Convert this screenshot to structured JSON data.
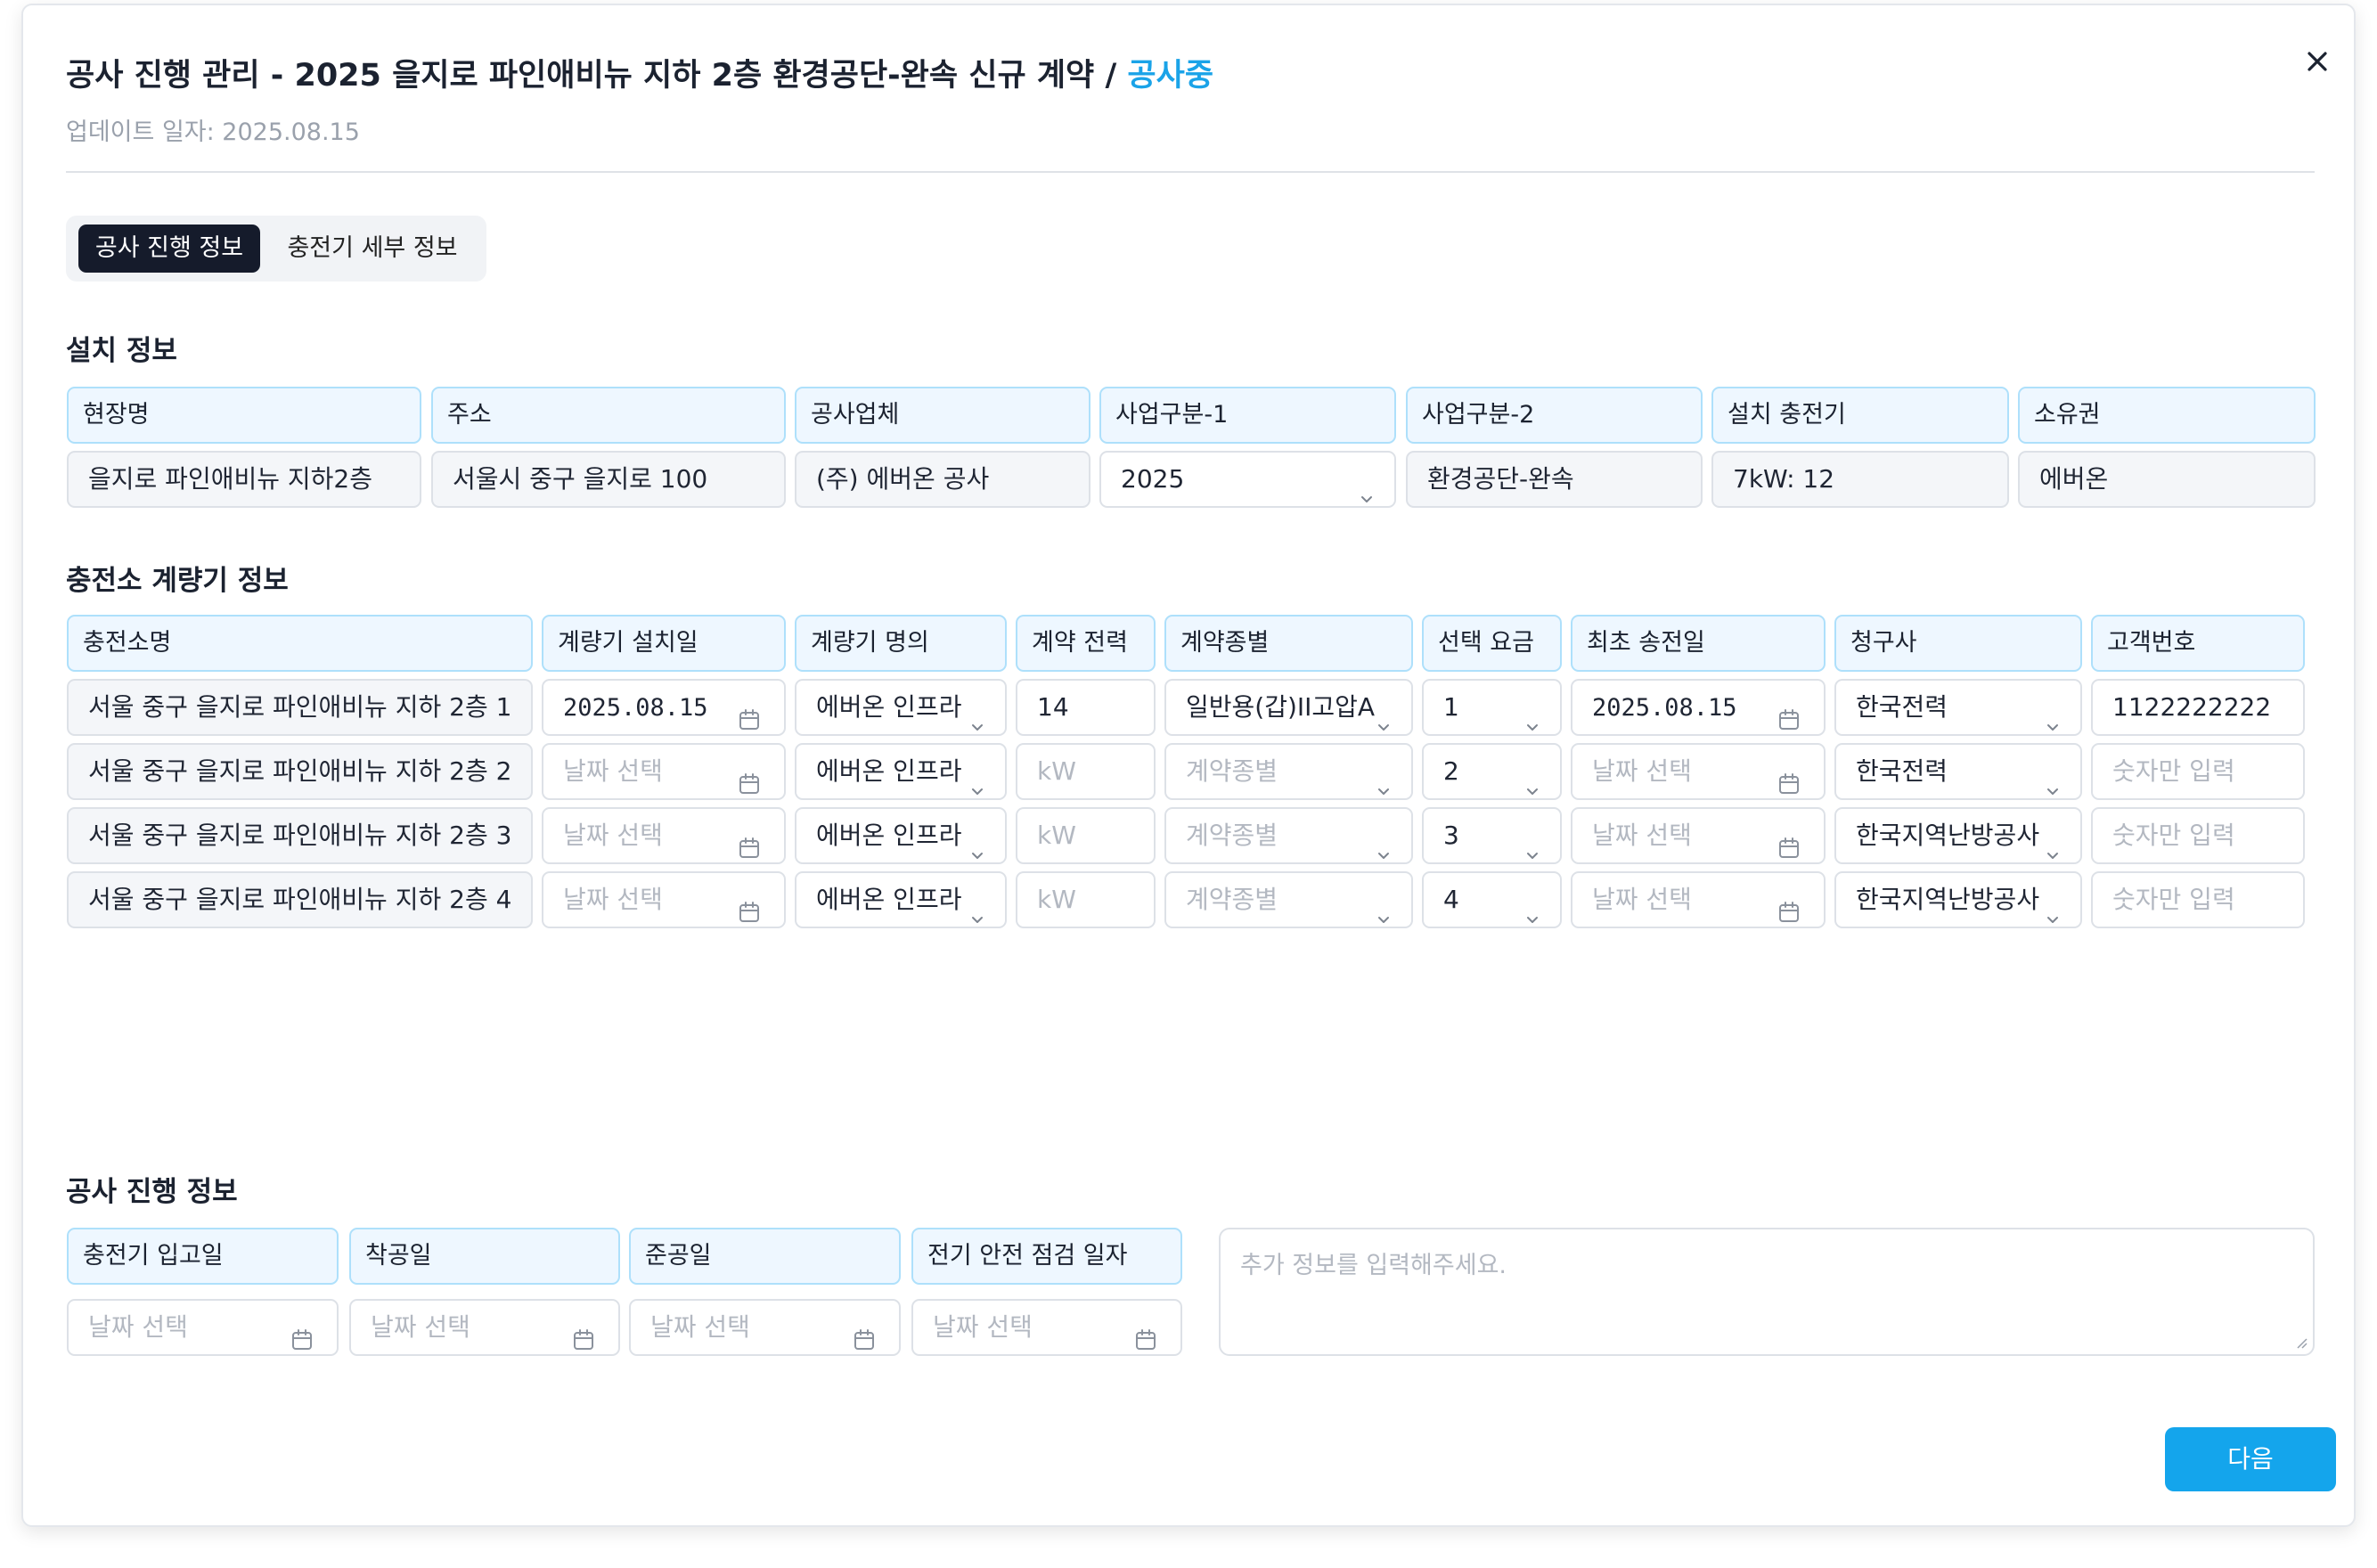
{
  "header": {
    "title": "공사 진행 관리 - 2025 을지로 파인애비뉴 지하 2층 환경공단-완속 신규 계약 / ",
    "status": "공사중",
    "updated": "업데이트 일자: 2025.08.15"
  },
  "tabs": [
    "공사 진행 정보",
    "충전기 세부 정보"
  ],
  "install": {
    "title": "설치 정보",
    "headers": [
      "현장명",
      "주소",
      "공사업체",
      "사업구분-1",
      "사업구분-2",
      "설치 충전기",
      "소유권"
    ],
    "values": [
      "을지로 파인애비뉴 지하2층",
      "서울시 중구 을지로 100",
      "(주) 에버온 공사",
      "2025",
      "환경공단-완속",
      "7kW: 12",
      "에버온"
    ]
  },
  "meter": {
    "title": "충전소 계량기 정보",
    "headers": [
      "충전소명",
      "계량기 설치일",
      "계량기 명의",
      "계약 전력",
      "계약종별",
      "선택 요금",
      "최초 송전일",
      "청구사",
      "고객번호"
    ],
    "rows": [
      {
        "name": "서울 중구 을지로 파인애비뉴 지하 2층 1",
        "install_date": "2025.08.15",
        "owner": "에버온 인프라",
        "power": "14",
        "contract_type": "일반용(갑)II고압A",
        "rate": "1",
        "first_date": "2025.08.15",
        "billing": "한국전력",
        "customer": "1122222222"
      },
      {
        "name": "서울 중구 을지로 파인애비뉴 지하 2층 2",
        "install_date": "",
        "owner": "에버온 인프라",
        "power": "",
        "contract_type": "",
        "rate": "2",
        "first_date": "",
        "billing": "한국전력",
        "customer": ""
      },
      {
        "name": "서울 중구 을지로 파인애비뉴 지하 2층 3",
        "install_date": "",
        "owner": "에버온 인프라",
        "power": "",
        "contract_type": "",
        "rate": "3",
        "first_date": "",
        "billing": "한국지역난방공사",
        "customer": ""
      },
      {
        "name": "서울 중구 을지로 파인애비뉴 지하 2층 4",
        "install_date": "",
        "owner": "에버온 인프라",
        "power": "",
        "contract_type": "",
        "rate": "4",
        "first_date": "",
        "billing": "한국지역난방공사",
        "customer": ""
      }
    ],
    "placeholders": {
      "date": "날짜 선택",
      "power": "kW",
      "contract_type": "계약종별",
      "customer": "숫자만 입력"
    }
  },
  "progress": {
    "title": "공사 진행 정보",
    "headers": [
      "충전기 입고일",
      "착공일",
      "준공일",
      "전기 안전 점검 일자"
    ],
    "placeholder": "날짜 선택",
    "notes_placeholder": "추가 정보를 입력해주세요."
  },
  "actions": {
    "next": "다음"
  },
  "icons": {
    "close": "close-icon",
    "calendar": "calendar-icon",
    "chevron": "chevron-down-icon"
  },
  "colors": {
    "accent": "#14a5ec",
    "status": "#1aa3e8",
    "tab_active": "#151b2b",
    "header_bg": "#eef7ff",
    "header_border": "#aee0fb"
  }
}
